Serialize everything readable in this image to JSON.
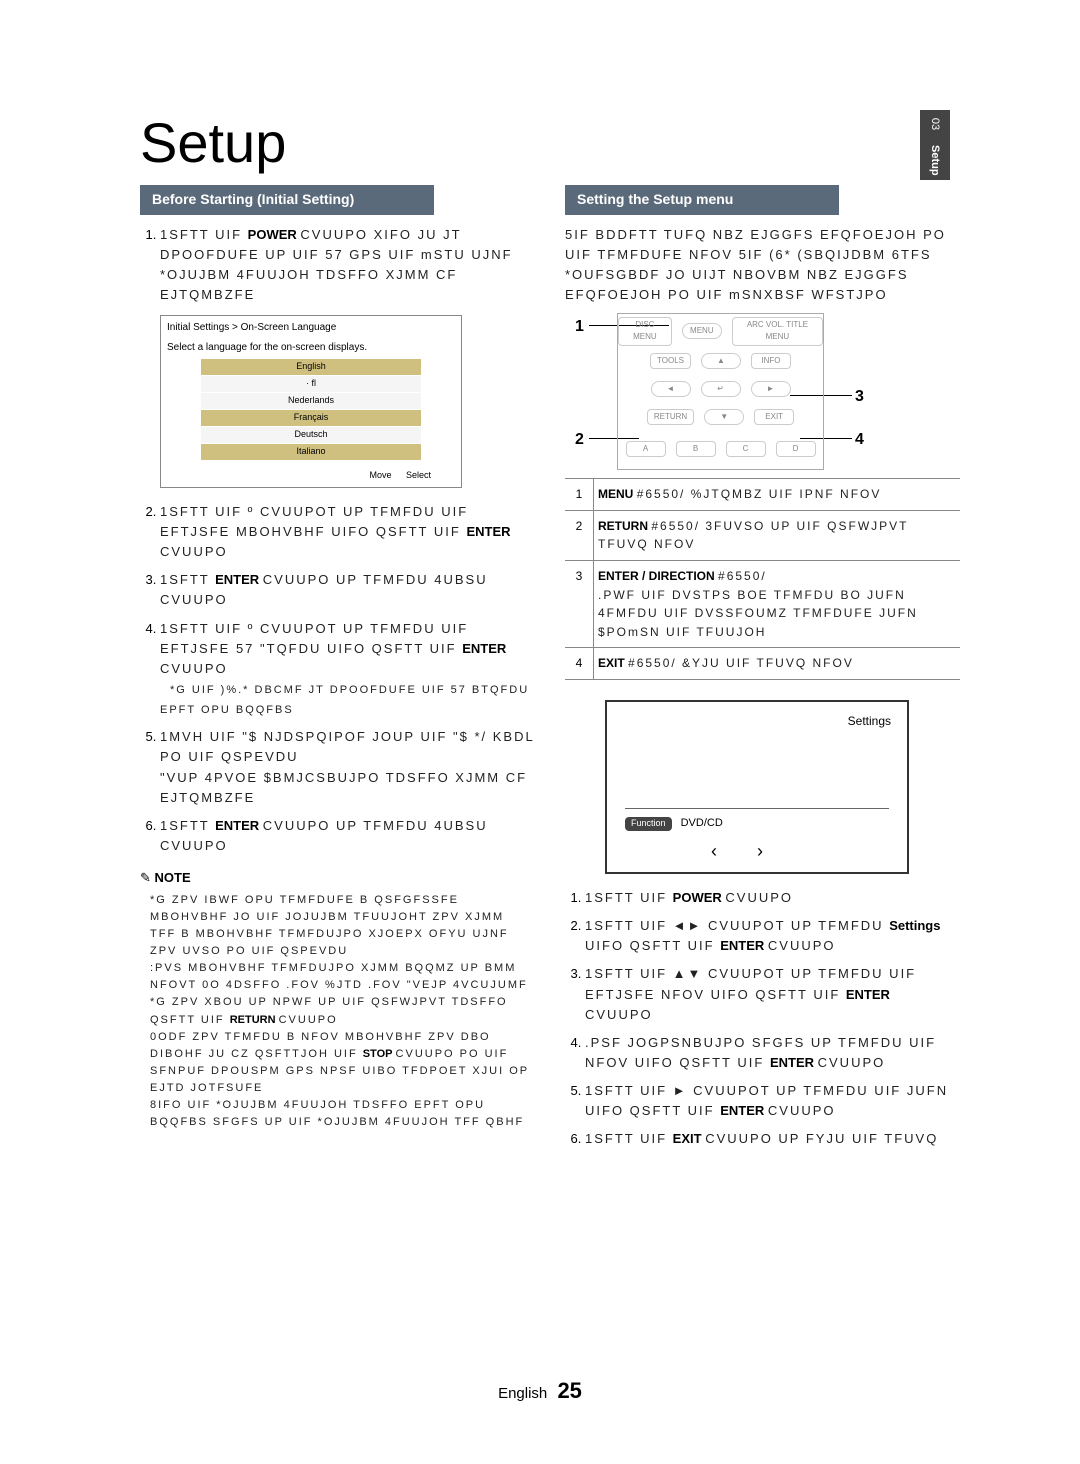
{
  "page": {
    "title": "Setup",
    "sideTab": {
      "num": "03",
      "label": "Setup"
    },
    "footer": {
      "lang": "English",
      "page": "25"
    }
  },
  "left": {
    "header": "Before Starting (Initial Setting)",
    "step1_a": "1SFTT UIF ",
    "step1_power": "POWER",
    "step1_b": " CVUUPO XIFO JU JT DPOOFDUFE UP UIF 57 GPS UIF mSTU UJNF",
    "step1_c": "*OJUJBM 4FUUJOH TDSFFO XJMM CF EJTQMBZFE",
    "langbox": {
      "title_a": "Initial Settings > On-Screen Language",
      "title_b": "Select a language for the on-screen displays.",
      "english": "English",
      "blank": "· fl",
      "nl": "Nederlands",
      "fr": "Français",
      "de": "Deutsch",
      "it": "Italiano",
      "move": "Move",
      "select": "Select"
    },
    "step2_a": "1SFTT UIF º CVUUPOT UP TFMFDU UIF EFTJSFE MBOHVBHF UIFO QSFTT UIF ",
    "step2_enter": "ENTER",
    "step2_b": " CVUUPO",
    "step3_a": "1SFTT ",
    "step3_enter": "ENTER",
    "step3_b": " CVUUPO UP TFMFDU 4UBSU CVUUPO",
    "step4_a": "1SFTT UIF º CVUUPOT UP TFMFDU UIF EFTJSFE 57 \"TQFDU UIFO QSFTT UIF ",
    "step4_enter": "ENTER",
    "step4_b": " CVUUPO",
    "step4_c": "*G UIF )%.* DBCMF JT DPOOFDUFE UIF 57 BTQFDU EPFT OPU BQQFBS",
    "step5": "1MVH UIF \"$ NJDSPQIPOF JOUP UIF \"$ */ KBDL PO UIF QSPEVDU",
    "step5_b": "\"VUP 4PVOE $BMJCSBUJPO TDSFFO XJMM CF EJTQMBZFE",
    "step6_a": "1SFTT ",
    "step6_enter": "ENTER",
    "step6_b": " CVUUPO UP TFMFDU 4UBSU CVUUPO",
    "note_label": "NOTE",
    "note_1a": "*G ZPV IBWF OPU TFMFDUFE B QSFGFSSFE MBOHVBHF JO UIF JOJUJBM TFUUJOHT ZPV XJMM TFF B MBOHVBHF TFMFDUJPO XJOEPX OFYU UJNF ZPV UVSO PO UIF QSPEVDU",
    "note_1b": ":PVS MBOHVBHF TFMFDUJPO XJMM BQQMZ UP BMM NFOVT  0O 4DSFFO .FOV  %JTD .FOV  \"VEJP  4VCUJUMF",
    "note_2a": "*G ZPV XBOU UP NPWF UP UIF QSFWJPVT TDSFFO QSFTT UIF ",
    "note_return": "RETURN",
    "note_2b": " CVUUPO",
    "note_3a": "0ODF ZPV TFMFDU B NFOV MBOHVBHF ZPV DBO DIBOHF JU CZ QSFTTJOH UIF ",
    "note_stop": "STOP",
    "note_3b": " CVUUPO PO UIF SFNPUF DPOUSPM GPS NPSF UIBO  TFDPOET XJUI OP EJTD JOTFSUFE",
    "note_4a": "8IFO UIF *OJUJBM 4FUUJOH TDSFFO EPFT OPU BQQFBS SFGFS UP UIF *OJUJBM 4FUUJOH  TFF QBHF "
  },
  "right": {
    "header": "Setting the Setup menu",
    "intro_a": "5IF BDDFTT TUFQ NBZ EJGGFS EFQFOEJOH PO UIF TFMFDUFE NFOV 5IF (6* (SBQIJDBM 6TFS *OUFSGBDF JO UIJT NBOVBM NBZ EJGGFS EFQFOEJOH PO UIF mSNXBSF WFSTJPO",
    "callouts": {
      "n1": "1",
      "n2": "2",
      "n3": "3",
      "n4": "4"
    },
    "remote": {
      "menu": "MENU",
      "tools": "TOOLS",
      "info": "INFO",
      "discmenu": "DISC MENU",
      "titlemenu": "ARC VOL.\nTITLE MENU",
      "return": "RETURN",
      "exit": "EXIT",
      "center": "↵",
      "a": "A",
      "b": "B",
      "c": "C",
      "d": "D"
    },
    "desc": {
      "r1_label": "MENU",
      "r1": "#6550/    %JTQMBZ UIF IPNF NFOV",
      "r2_label": "RETURN",
      "r2": "#6550/   3FUVSO UP UIF QSFWJPVT TFUVQ NFOV",
      "r3_label": "ENTER / DIRECTION",
      "r3_a": "#6550/",
      "r3_b": ".PWF UIF DVSTPS BOE TFMFDU BO JUFN",
      "r3_c": "4FMFDU UIF DVSSFOUMZ TFMFDUFE JUFN",
      "r3_d": "$POmSN UIF TFUUJOH",
      "r4_label": "EXIT",
      "r4": "#6550/    &YJU UIF TFUVQ NFOV"
    },
    "tv": {
      "settings": "Settings",
      "function": "Function",
      "dvd": "DVD/CD",
      "left": "‹",
      "right": "›"
    },
    "step1_a": "1SFTT UIF ",
    "step1_power": "POWER",
    "step1_b": " CVUUPO",
    "step2_a": "1SFTT UIF ◄► CVUUPOT UP TFMFDU ",
    "step2_settings": "Settings",
    "step2_b": " UIFO QSFTT UIF ",
    "step2_enter": "ENTER",
    "step2_c": " CVUUPO",
    "step3_a": "1SFTT UIF ▲▼ CVUUPOT UP TFMFDU UIF EFTJSFE NFOV UIFO QSFTT UIF ",
    "step3_enter": "ENTER",
    "step3_b": " CVUUPO",
    "step4_a": ".PSF JOGPSNBUJPO SFGFS UP TFMFDU UIF NFOV UIFO QSFTT UIF ",
    "step4_enter": "ENTER",
    "step4_b": " CVUUPO",
    "step5_a": "1SFTT UIF ► CVUUPOT UP TFMFDU UIF JUFN UIFO QSFTT UIF ",
    "step5_enter": "ENTER",
    "step5_b": " CVUUPO",
    "step6_a": "1SFTT UIF ",
    "step6_exit": "EXIT",
    "step6_b": " CVUUPO UP FYJU UIF TFUVQ"
  }
}
